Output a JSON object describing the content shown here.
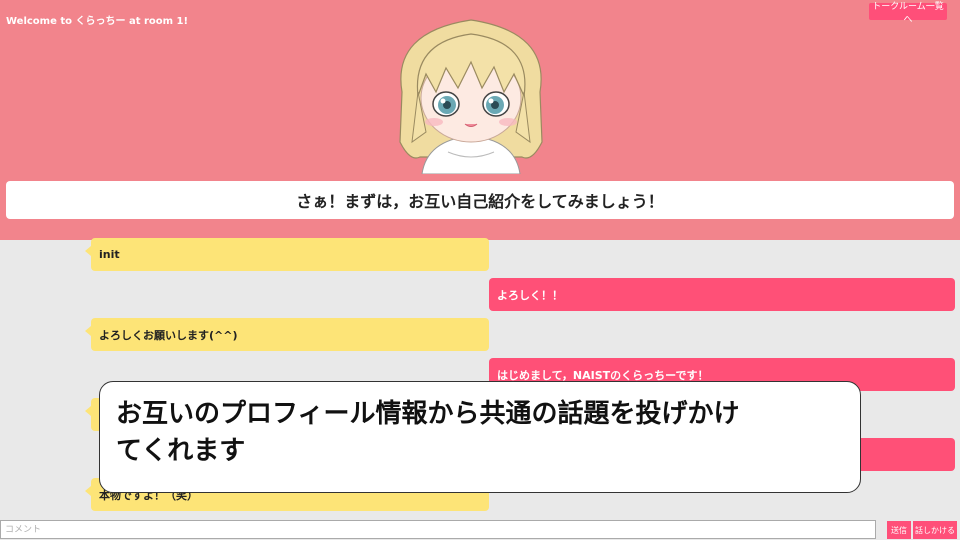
{
  "header": {
    "welcome_text": "Welcome to くらっちー at room 1!",
    "room_list_button": "トークルーム一覧へ",
    "prompt": "さぁ！まずは，お互い自己紹介をしてみましょう！"
  },
  "messages": [
    {
      "side": "partner",
      "text": "init"
    },
    {
      "side": "self",
      "text": "よろしく！！"
    },
    {
      "side": "partner",
      "text": "よろしくお願いします(^^)"
    },
    {
      "side": "self",
      "text": "はじめまして，NAISTのくらっちーです！"
    },
    {
      "side": "partner",
      "text": "本物ですよ！（笑）"
    }
  ],
  "caption": {
    "line1": "お互いのプロフィール情報から共通の話題を投げかけ",
    "line2": "てくれます"
  },
  "input": {
    "placeholder": "コメント",
    "send_label": "送信",
    "talk_label": "話しかける"
  },
  "colors": {
    "header_bg": "#f2848c",
    "partner_bubble": "#fde477",
    "self_bubble": "#ff5077",
    "button": "#ff4f79"
  }
}
